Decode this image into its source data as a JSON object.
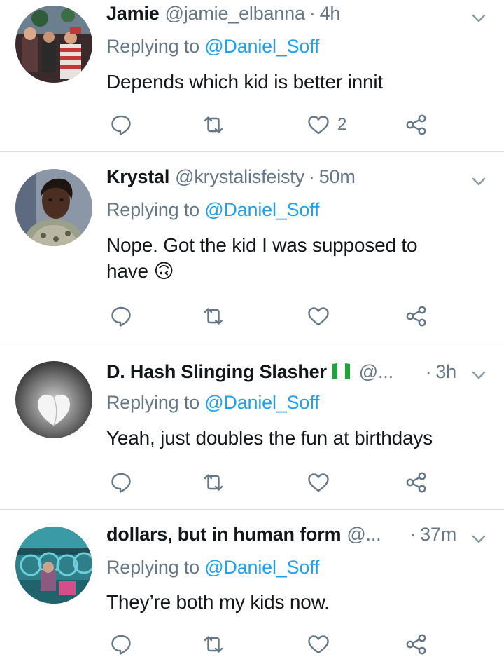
{
  "tweets": [
    {
      "name": "Jamie",
      "handle": "@jamie_elbanna",
      "separator": "·",
      "time": "4h",
      "replying_prefix": "Replying to",
      "replying_to": "@Daniel_Soff",
      "text": "Depends which kid is better innit",
      "like_count": "2",
      "avatar_icon": "avatar-photo-group"
    },
    {
      "name": "Krystal",
      "handle": "@krystalisfeisty",
      "separator": "·",
      "time": "50m",
      "replying_prefix": "Replying to",
      "replying_to": "@Daniel_Soff",
      "text": "Nope. Got the kid I was supposed to have 🙃",
      "like_count": "",
      "avatar_icon": "avatar-photo-portrait"
    },
    {
      "name": "D. Hash Slinging Slasher",
      "flag_icon": "nigeria-flag-icon",
      "handle": "@...",
      "separator": "·",
      "time": "3h",
      "replying_prefix": "Replying to",
      "replying_to": "@Daniel_Soff",
      "text": "Yeah, just doubles the fun at birthdays",
      "like_count": "",
      "avatar_icon": "avatar-photo-monochrome"
    },
    {
      "name": "dollars, but in human form",
      "handle": "@...",
      "separator": "·",
      "time": "37m",
      "replying_prefix": "Replying to",
      "replying_to": "@Daniel_Soff",
      "text": "They’re both my kids now.",
      "like_count": "",
      "avatar_icon": "avatar-photo-scene"
    }
  ],
  "colors": {
    "text": "#14171a",
    "secondary": "#657786",
    "link": "#1da1f2",
    "divider": "#d9dee2"
  }
}
